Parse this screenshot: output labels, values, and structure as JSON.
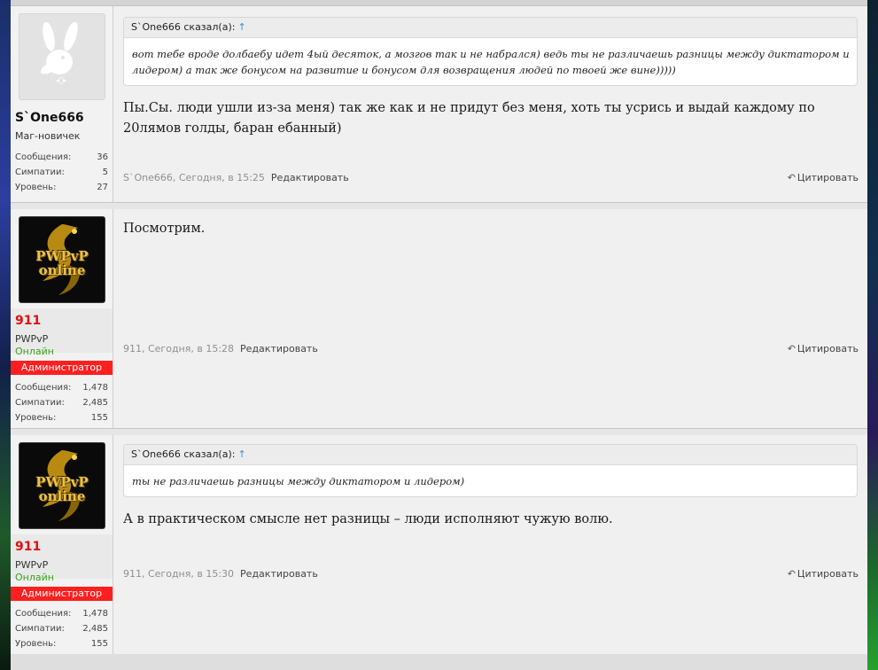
{
  "posts": [
    {
      "author": "S`One666",
      "author_title": "Маг-новичек",
      "author_color": "#111111",
      "online": "",
      "badge": "",
      "avatar": "playboy-bunny-icon",
      "stats": [
        {
          "label": "Сообщения:",
          "value": "36"
        },
        {
          "label": "Симпатии:",
          "value": "5"
        },
        {
          "label": "Уровень:",
          "value": "27"
        }
      ],
      "quote": {
        "header": "S`One666 сказал(а):",
        "arrow": "↑",
        "text": "вот тебе вроде долбаебу идет 4ый десяток, а мозгов так и не набрался) ведь ты не различаешь разницы между диктатором и лидером) а так же бонусом на развитие и бонусом для возвращения людей по твоей же вине)))))"
      },
      "message": "Пы.Сы. люди ушли из-за меня) так же как и не придут без меня, хоть ты усрись и выдай каждому по 20лямов голды, баран ебанный)",
      "meta": "S`One666, Сегодня, в 15:25",
      "edit": "Редактировать",
      "reply": "Цитировать"
    },
    {
      "author": "911",
      "author_title": "PWPvP",
      "author_color": "#e01010",
      "online": "Онлайн",
      "badge": "Администратор",
      "avatar": "pwpvp-dragon-logo",
      "avatar_text": "PWPvP online",
      "stats": [
        {
          "label": "Сообщения:",
          "value": "1,478"
        },
        {
          "label": "Симпатии:",
          "value": "2,485"
        },
        {
          "label": "Уровень:",
          "value": "155"
        }
      ],
      "message": "Посмотрим.",
      "meta": "911, Сегодня, в 15:28",
      "edit": "Редактировать",
      "reply": "Цитировать"
    },
    {
      "author": "911",
      "author_title": "PWPvP",
      "author_color": "#e01010",
      "online": "Онлайн",
      "badge": "Администратор",
      "avatar": "pwpvp-dragon-logo",
      "avatar_text": "PWPvP online",
      "stats": [
        {
          "label": "Сообщения:",
          "value": "1,478"
        },
        {
          "label": "Симпатии:",
          "value": "2,485"
        },
        {
          "label": "Уровень:",
          "value": "155"
        }
      ],
      "quote": {
        "header": "S`One666 сказал(а):",
        "arrow": "↑",
        "text": "ты не различаешь разницы между диктатором и лидером)"
      },
      "message": "А в практическом смысле нет разницы – люди исполняют чужую волю.",
      "meta": "911, Сегодня, в 15:30",
      "edit": "Редактировать",
      "reply": "Цитировать"
    }
  ],
  "colors": {
    "admin_badge": "#ff1f1f",
    "online": "#3aa21c",
    "quote_arrow": "#3b8fd8"
  }
}
